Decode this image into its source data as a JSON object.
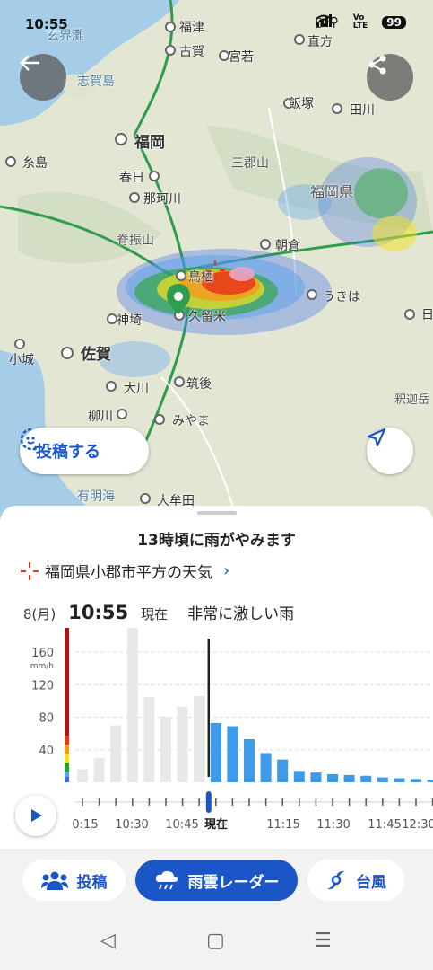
{
  "status": {
    "time": "10:55",
    "battery": "99"
  },
  "map": {
    "labels": {
      "genkainada": "玄界灘",
      "fukutsu": "福津",
      "koga": "古賀",
      "nogata": "直方",
      "shikanoshima": "志賀島",
      "miyawaka": "宮若",
      "iizuka": "飯塚",
      "tagawa": "田川",
      "fukuoka": "福岡",
      "itoshima": "糸島",
      "kasuga": "春日",
      "sangunsan": "三郡山",
      "nakagawa": "那珂川",
      "fukuoka_pref": "福岡県",
      "seburisan": "脊振山",
      "asakura": "朝倉",
      "tosu": "鳥栖",
      "ukiha": "うきは",
      "kurume": "久留米",
      "kanzaki": "神埼",
      "saga": "佐賀",
      "ogi": "小城",
      "okawa": "大川",
      "chikugo": "筑後",
      "yanagawa": "柳川",
      "miyama": "みやま",
      "ariakekai": "有明海",
      "omuta": "大牟田",
      "shakadake": "釈迦岳",
      "hita": "日"
    },
    "post_button": "投稿する"
  },
  "sheet": {
    "headline": "13時頃に雨がやみます",
    "place": "福岡県小郡市平方の天気",
    "date": "8(月)",
    "time": "10:55",
    "now_label": "現在",
    "desc": "非常に激しい雨"
  },
  "chart_data": {
    "type": "bar",
    "ylabel": "mm/h",
    "y_ticks": [
      40,
      80,
      120,
      160
    ],
    "ylim": [
      0,
      190
    ],
    "x_tick_labels": [
      "0:15",
      "10:30",
      "10:45",
      "現在",
      "11:15",
      "11:30",
      "11:45",
      "12:30"
    ],
    "past": [
      16,
      30,
      70,
      197,
      105,
      81,
      93,
      106
    ],
    "forecast": [
      73,
      69,
      53,
      36,
      28,
      14,
      12,
      10,
      9,
      8,
      6,
      5,
      4,
      3
    ],
    "colors": {
      "past": "#e8e8e8",
      "forecast": "#3d9be9",
      "now_line": "#222222"
    },
    "scale_colors": [
      "#3d6ee8",
      "#5aa0f0",
      "#1fa61f",
      "#f5e21b",
      "#f59a1b",
      "#e8361b",
      "#a8161b"
    ]
  },
  "tabs": [
    {
      "label": "投稿",
      "icon": "people-icon"
    },
    {
      "label": "雨雲レーダー",
      "icon": "rain-cloud-icon"
    },
    {
      "label": "台風",
      "icon": "typhoon-icon"
    }
  ]
}
